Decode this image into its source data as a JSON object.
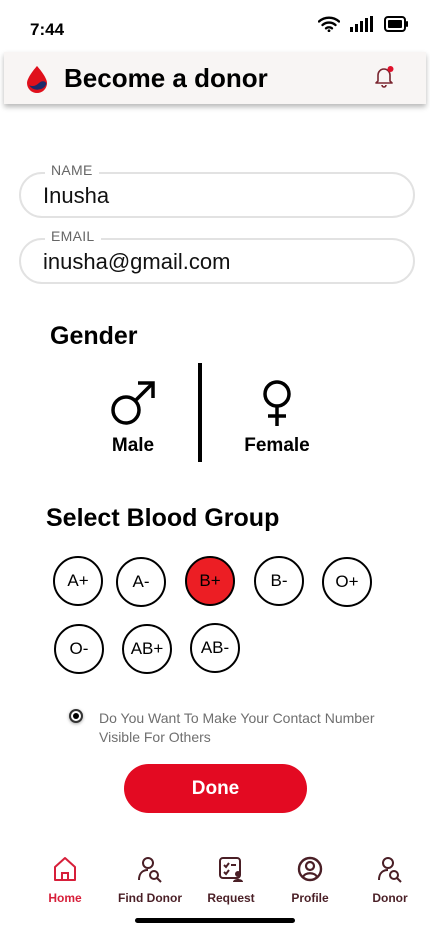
{
  "status": {
    "time": "7:44"
  },
  "header": {
    "title": "Become a donor"
  },
  "form": {
    "name": {
      "label": "NAME",
      "value": "Inusha"
    },
    "email": {
      "label": "EMAIL",
      "value": "inusha@gmail.com"
    }
  },
  "gender": {
    "title": "Gender",
    "options": [
      {
        "label": "Male"
      },
      {
        "label": "Female"
      }
    ]
  },
  "blood_group": {
    "title": "Select Blood Group",
    "options": [
      "A+",
      "A-",
      "B+",
      "B-",
      "O+",
      "O-",
      "AB+",
      "AB-"
    ],
    "selected": "B+"
  },
  "consent": {
    "text": "Do You Want To Make Your Contact Number Visible For Others",
    "checked": true
  },
  "actions": {
    "done_label": "Done"
  },
  "nav": {
    "items": [
      {
        "label": "Home",
        "icon": "home-icon",
        "active": true
      },
      {
        "label": "Find Donor",
        "icon": "find-donor-icon"
      },
      {
        "label": "Request",
        "icon": "request-icon"
      },
      {
        "label": "Profile",
        "icon": "profile-icon"
      },
      {
        "label": "Donor",
        "icon": "donor-icon"
      }
    ]
  },
  "colors": {
    "accent": "#e30a22",
    "selected_chip": "#ec1e24",
    "nav_active": "#d71f3a"
  }
}
